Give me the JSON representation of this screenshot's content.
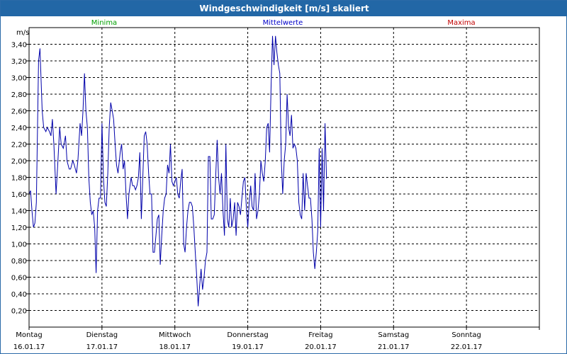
{
  "window": {
    "title": "Windgeschwindigkeit [m/s] skaliert"
  },
  "legend": {
    "min": "Minima",
    "mean": "Mittelwerte",
    "max": "Maxima"
  },
  "colors": {
    "min": "#00a000",
    "mean": "#0000c8",
    "max": "#c00000",
    "line": "#0000aa",
    "grid": "#000000"
  },
  "chart_data": {
    "type": "line",
    "title": "Windgeschwindigkeit [m/s] skaliert",
    "ylabel": "m/s",
    "xlabel": "",
    "ylim": [
      0,
      3.6
    ],
    "xlim": [
      0,
      7
    ],
    "grid": true,
    "legend": "top",
    "yticks": [
      "0,20",
      "0,40",
      "0,60",
      "0,80",
      "1,00",
      "1,20",
      "1,40",
      "1,60",
      "1,80",
      "2,00",
      "2,20",
      "2,40",
      "2,60",
      "2,80",
      "3,00",
      "3,20",
      "3,40"
    ],
    "xticks": [
      {
        "day": "Montag",
        "date": "16.01.17"
      },
      {
        "day": "Dienstag",
        "date": "17.01.17"
      },
      {
        "day": "Mittwoch",
        "date": "18.01.17"
      },
      {
        "day": "Donnerstag",
        "date": "19.01.17"
      },
      {
        "day": "Freitag",
        "date": "20.01.17"
      },
      {
        "day": "Samstag",
        "date": "21.01.17"
      },
      {
        "day": "Sonntag",
        "date": "22.01.17"
      }
    ],
    "series": [
      {
        "name": "Mittelwerte",
        "values": [
          [
            0.0,
            1.6
          ],
          [
            0.02,
            1.64
          ],
          [
            0.04,
            1.4
          ],
          [
            0.06,
            1.2
          ],
          [
            0.08,
            1.25
          ],
          [
            0.1,
            1.5
          ],
          [
            0.13,
            3.2
          ],
          [
            0.15,
            3.35
          ],
          [
            0.18,
            2.6
          ],
          [
            0.2,
            2.4
          ],
          [
            0.23,
            2.35
          ],
          [
            0.25,
            2.4
          ],
          [
            0.28,
            2.35
          ],
          [
            0.3,
            2.3
          ],
          [
            0.32,
            2.5
          ],
          [
            0.34,
            2.2
          ],
          [
            0.37,
            1.6
          ],
          [
            0.39,
            1.9
          ],
          [
            0.42,
            2.4
          ],
          [
            0.44,
            2.2
          ],
          [
            0.47,
            2.15
          ],
          [
            0.5,
            2.3
          ],
          [
            0.52,
            2.0
          ],
          [
            0.55,
            1.9
          ],
          [
            0.57,
            1.9
          ],
          [
            0.6,
            2.0
          ],
          [
            0.62,
            1.95
          ],
          [
            0.65,
            1.85
          ],
          [
            0.67,
            2.0
          ],
          [
            0.7,
            2.45
          ],
          [
            0.72,
            2.3
          ],
          [
            0.74,
            2.6
          ],
          [
            0.76,
            3.05
          ],
          [
            0.78,
            2.6
          ],
          [
            0.8,
            2.4
          ],
          [
            0.82,
            1.8
          ],
          [
            0.84,
            1.5
          ],
          [
            0.86,
            1.35
          ],
          [
            0.88,
            1.4
          ],
          [
            0.9,
            1.2
          ],
          [
            0.92,
            0.65
          ],
          [
            0.94,
            1.4
          ],
          [
            0.96,
            1.55
          ],
          [
            0.98,
            1.55
          ],
          [
            1.0,
            2.45
          ],
          [
            1.02,
            1.8
          ],
          [
            1.04,
            1.5
          ],
          [
            1.06,
            1.45
          ],
          [
            1.08,
            1.85
          ],
          [
            1.1,
            2.4
          ],
          [
            1.12,
            2.7
          ],
          [
            1.14,
            2.6
          ],
          [
            1.16,
            2.5
          ],
          [
            1.18,
            2.2
          ],
          [
            1.2,
            1.95
          ],
          [
            1.22,
            1.85
          ],
          [
            1.25,
            2.1
          ],
          [
            1.27,
            2.2
          ],
          [
            1.29,
            1.9
          ],
          [
            1.31,
            2.0
          ],
          [
            1.33,
            1.6
          ],
          [
            1.35,
            1.3
          ],
          [
            1.37,
            1.6
          ],
          [
            1.4,
            1.8
          ],
          [
            1.42,
            1.7
          ],
          [
            1.44,
            1.7
          ],
          [
            1.46,
            1.65
          ],
          [
            1.48,
            1.7
          ],
          [
            1.5,
            1.8
          ],
          [
            1.52,
            2.1
          ],
          [
            1.54,
            1.3
          ],
          [
            1.56,
            1.8
          ],
          [
            1.58,
            2.3
          ],
          [
            1.6,
            2.35
          ],
          [
            1.62,
            2.2
          ],
          [
            1.64,
            1.85
          ],
          [
            1.66,
            1.6
          ],
          [
            1.68,
            1.6
          ],
          [
            1.7,
            0.9
          ],
          [
            1.72,
            0.9
          ],
          [
            1.74,
            1.1
          ],
          [
            1.76,
            1.3
          ],
          [
            1.78,
            1.35
          ],
          [
            1.8,
            0.75
          ],
          [
            1.82,
            1.1
          ],
          [
            1.84,
            1.4
          ],
          [
            1.86,
            1.55
          ],
          [
            1.88,
            1.6
          ],
          [
            1.9,
            1.95
          ],
          [
            1.92,
            1.85
          ],
          [
            1.94,
            2.2
          ],
          [
            1.96,
            1.75
          ],
          [
            1.98,
            1.7
          ],
          [
            2.0,
            1.75
          ],
          [
            2.02,
            1.8
          ],
          [
            2.04,
            1.6
          ],
          [
            2.06,
            1.55
          ],
          [
            2.08,
            1.75
          ],
          [
            2.1,
            1.9
          ],
          [
            2.12,
            1.0
          ],
          [
            2.14,
            0.9
          ],
          [
            2.16,
            1.2
          ],
          [
            2.18,
            1.4
          ],
          [
            2.2,
            1.5
          ],
          [
            2.22,
            1.5
          ],
          [
            2.24,
            1.45
          ],
          [
            2.26,
            1.2
          ],
          [
            2.28,
            0.9
          ],
          [
            2.3,
            0.6
          ],
          [
            2.32,
            0.25
          ],
          [
            2.34,
            0.5
          ],
          [
            2.36,
            0.7
          ],
          [
            2.38,
            0.45
          ],
          [
            2.4,
            0.6
          ],
          [
            2.42,
            0.8
          ],
          [
            2.44,
            0.9
          ],
          [
            2.46,
            2.05
          ],
          [
            2.48,
            2.05
          ],
          [
            2.5,
            1.3
          ],
          [
            2.52,
            1.3
          ],
          [
            2.54,
            1.35
          ],
          [
            2.56,
            1.8
          ],
          [
            2.58,
            2.25
          ],
          [
            2.6,
            1.8
          ],
          [
            2.62,
            1.6
          ],
          [
            2.64,
            1.85
          ],
          [
            2.66,
            1.4
          ],
          [
            2.68,
            1.1
          ],
          [
            2.7,
            2.2
          ],
          [
            2.72,
            1.3
          ],
          [
            2.74,
            1.2
          ],
          [
            2.76,
            1.55
          ],
          [
            2.78,
            1.2
          ],
          [
            2.8,
            1.3
          ],
          [
            2.82,
            1.5
          ],
          [
            2.84,
            1.1
          ],
          [
            2.86,
            1.5
          ],
          [
            2.88,
            1.45
          ],
          [
            2.9,
            1.35
          ],
          [
            2.92,
            1.55
          ],
          [
            2.94,
            1.75
          ],
          [
            2.96,
            1.8
          ],
          [
            2.98,
            1.45
          ],
          [
            3.0,
            1.2
          ],
          [
            3.02,
            1.5
          ],
          [
            3.04,
            1.7
          ],
          [
            3.06,
            1.45
          ],
          [
            3.08,
            1.4
          ],
          [
            3.1,
            1.85
          ],
          [
            3.12,
            1.3
          ],
          [
            3.14,
            1.4
          ],
          [
            3.16,
            1.6
          ],
          [
            3.18,
            2.0
          ],
          [
            3.2,
            1.85
          ],
          [
            3.22,
            1.75
          ],
          [
            3.24,
            2.0
          ],
          [
            3.26,
            2.4
          ],
          [
            3.28,
            2.45
          ],
          [
            3.3,
            2.1
          ],
          [
            3.32,
            2.9
          ],
          [
            3.34,
            3.5
          ],
          [
            3.36,
            3.15
          ],
          [
            3.38,
            3.5
          ],
          [
            3.4,
            3.3
          ],
          [
            3.42,
            3.15
          ],
          [
            3.44,
            3.05
          ],
          [
            3.46,
            2.0
          ],
          [
            3.48,
            1.6
          ],
          [
            3.5,
            2.0
          ],
          [
            3.52,
            2.2
          ],
          [
            3.54,
            2.8
          ],
          [
            3.56,
            2.4
          ],
          [
            3.58,
            2.3
          ],
          [
            3.6,
            2.55
          ],
          [
            3.62,
            2.15
          ],
          [
            3.64,
            2.2
          ],
          [
            3.66,
            2.15
          ],
          [
            3.68,
            2.0
          ],
          [
            3.7,
            1.5
          ],
          [
            3.72,
            1.35
          ],
          [
            3.74,
            1.3
          ],
          [
            3.76,
            1.85
          ],
          [
            3.78,
            1.4
          ],
          [
            3.8,
            1.85
          ],
          [
            3.82,
            1.7
          ],
          [
            3.84,
            1.55
          ],
          [
            3.86,
            1.55
          ],
          [
            3.88,
            1.3
          ],
          [
            3.9,
            0.9
          ],
          [
            3.92,
            0.7
          ],
          [
            3.94,
            0.9
          ],
          [
            3.96,
            1.15
          ],
          [
            3.98,
            2.15
          ],
          [
            4.0,
            1.2
          ],
          [
            4.02,
            2.15
          ],
          [
            4.04,
            1.4
          ],
          [
            4.06,
            2.45
          ],
          [
            4.08,
            1.78
          ]
        ]
      }
    ]
  }
}
